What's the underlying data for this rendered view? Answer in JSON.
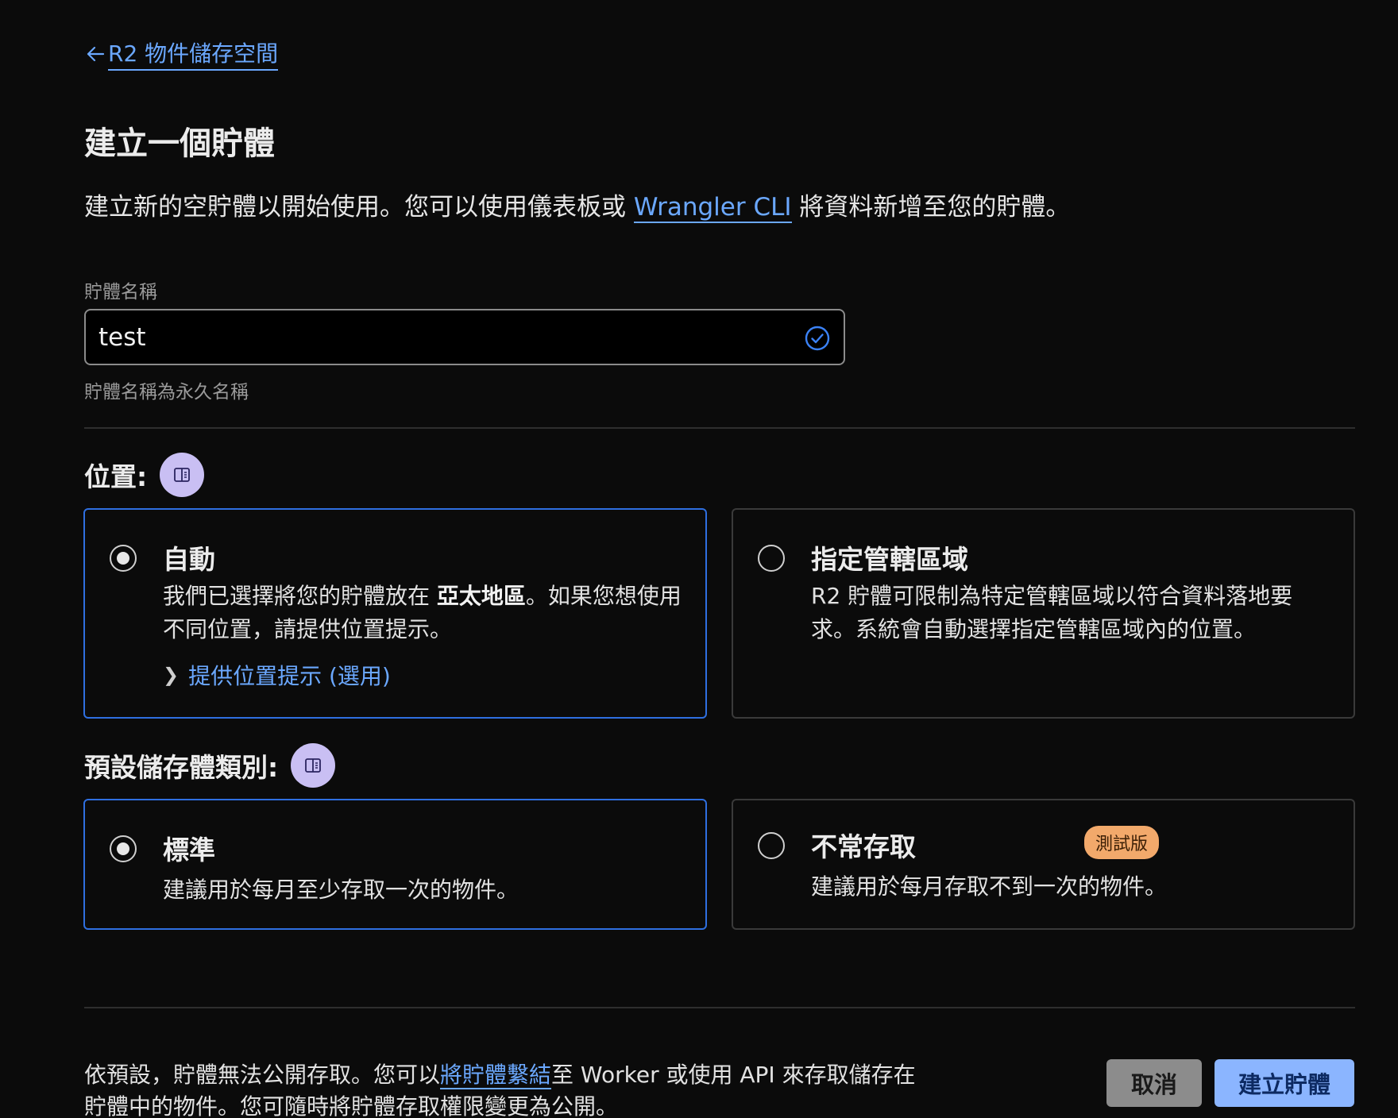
{
  "back_link": {
    "label": "R2 物件儲存空間"
  },
  "page": {
    "title": "建立一個貯體",
    "subtitle_before": "建立新的空貯體以開始使用。您可以使用儀表板或 ",
    "subtitle_link": "Wrangler CLI",
    "subtitle_after": " 將資料新增至您的貯體。"
  },
  "bucket_name": {
    "label": "貯體名稱",
    "value": "test",
    "hint": "貯體名稱為永久名稱"
  },
  "location": {
    "heading": "位置:",
    "options": [
      {
        "title": "自動",
        "desc_before": "我們已選擇將您的貯體放在 ",
        "desc_bold": "亞太地區",
        "desc_after": "。如果您想使用不同位置，請提供位置提示。",
        "toggle_label": "提供位置提示 (選用)",
        "selected": true
      },
      {
        "title": "指定管轄區域",
        "desc": "R2 貯體可限制為特定管轄區域以符合資料落地要求。系統會自動選擇指定管轄區域內的位置。",
        "selected": false
      }
    ]
  },
  "storage_class": {
    "heading": "預設儲存體類別:",
    "options": [
      {
        "title": "標準",
        "desc": "建議用於每月至少存取一次的物件。",
        "selected": true
      },
      {
        "title": "不常存取",
        "badge": "測試版",
        "desc": "建議用於每月存取不到一次的物件。",
        "selected": false
      }
    ]
  },
  "footer": {
    "text_before": "依預設，貯體無法公開存取。您可以",
    "text_link": "將貯體繫結",
    "text_after": "至 Worker 或使用 API 來存取儲存在貯體中的物件。您可隨時將貯體存取權限變更為公開。",
    "cancel_label": "取消",
    "create_label": "建立貯體"
  },
  "colors": {
    "accent_link": "#6ba8ff",
    "selected_border": "#2f6fe0",
    "badge_doc": "#c9bff3",
    "badge_beta": "#f2a96b",
    "primary_button": "#8bb5ff"
  }
}
